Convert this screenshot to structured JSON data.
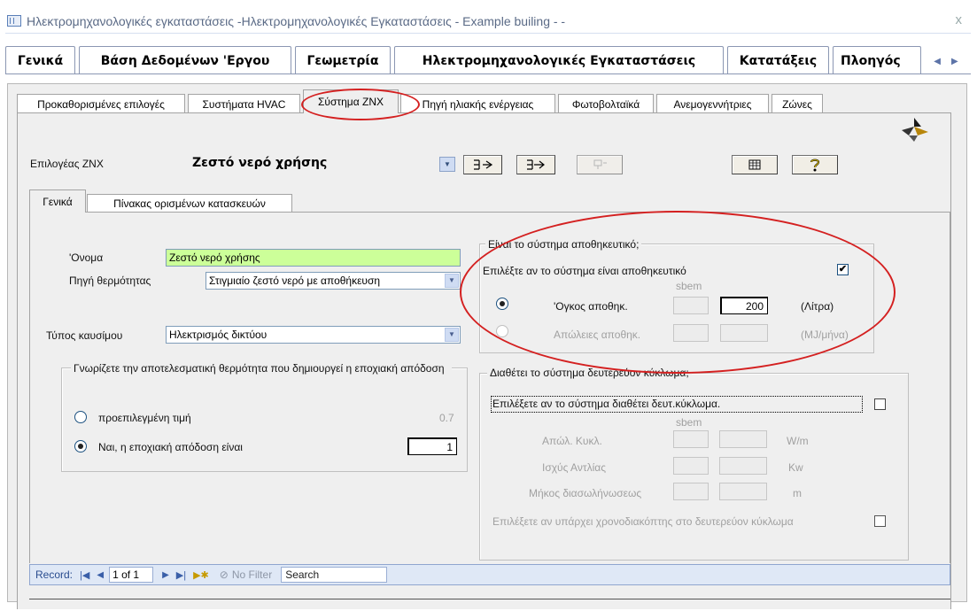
{
  "window": {
    "title": "Ηλεκτρομηχανολογικές εγκαταστάσεις -Ηλεκτρομηχανολογικές Εγκαταστάσεις - Example builing - -",
    "close_glyph": "x"
  },
  "main_tabs": [
    {
      "label": "Γενικά"
    },
    {
      "label": "Βάση Δεδομένων 'Εργου"
    },
    {
      "label": "Γεωμετρία"
    },
    {
      "label": "Ηλεκτρομηχανολογικές Εγκαταστάσεις"
    },
    {
      "label": "Κατατάξεις"
    },
    {
      "label": "Πλοηγός"
    }
  ],
  "sub_tabs": [
    {
      "label": "Προκαθορισμένες επιλογές"
    },
    {
      "label": "Συστήματα HVAC"
    },
    {
      "label": "Σύστημα ΖΝΧ"
    },
    {
      "label": "Πηγή ηλιακής ενέργειας"
    },
    {
      "label": "Φωτοβολταϊκά"
    },
    {
      "label": "Ανεμογεννήτριες"
    },
    {
      "label": "Ζώνες"
    }
  ],
  "selector": {
    "label": "Επιλογέας ΖΝΧ",
    "value": "Ζεστό νερό χρήσης"
  },
  "inner_tabs": [
    {
      "label": "Γενικά"
    },
    {
      "label": "Πίνακας ορισμένων κατασκευών"
    }
  ],
  "form": {
    "name_label": "'Ονομα",
    "name_value": "Ζεστό νερό χρήσης",
    "heat_source_label": "Πηγή θερμότητας",
    "heat_source_value": "Στιγμιαίο ζεστό νερό με αποθήκευση",
    "fuel_label": "Τύπος καυσίμου",
    "fuel_value": "Ηλεκτρισμός δικτύου",
    "efficiency_group": "Γνωρίζετε την αποτελεσματική θερμότητα που δημιουργεί η εποχιακή απόδοση",
    "default_label": "προεπιλεγμένη τιμή",
    "default_value": "0.7",
    "yes_label": "Ναι, η εποχιακή απόδοση είναι",
    "yes_value": "1"
  },
  "storage": {
    "group": "Είναι το σύστημα αποθηκευτικό;",
    "check_label": "Επιλέξτε αν το σύστημα είναι αποθηκευτικό",
    "checked_glyph": "✔",
    "sbem": "sbem",
    "volume_label": "'Ογκος αποθηκ.",
    "volume_value": "200",
    "volume_unit": "(Λίτρα)",
    "losses_label": "Απώλειες αποθηκ.",
    "losses_unit": "(MJ/μήνα)"
  },
  "secondary": {
    "group": "Διαθέτει το σύστημα δευτερεύον κύκλωμα;",
    "check_label": "Επιλέξετε αν το σύστημα διαθέτει δευτ.κύκλωμα.",
    "sbem": "sbem",
    "loss_label": "Απώλ. Κυκλ.",
    "loss_unit": "W/m",
    "pump_label": "Ισχύς Αντλίας",
    "pump_unit": "Kw",
    "length_label": "Μήκος διασωλήνωσεως",
    "length_unit": "m",
    "timer_label": "Επιλέξετε αν υπάρχει χρονοδιακόπτης στο δευτερεύον κύκλωμα"
  },
  "recordbar": {
    "label": "Record:",
    "position": "1 of 1",
    "filter": "No Filter",
    "search": "Search"
  },
  "colors": {
    "accent_green": "#ccff99",
    "highlight_red": "#d42020"
  }
}
